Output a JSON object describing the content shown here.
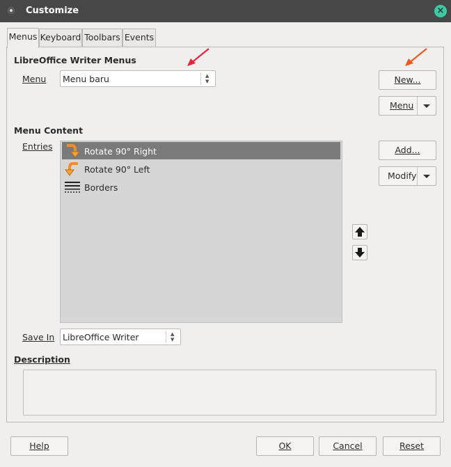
{
  "window": {
    "title": "Customize"
  },
  "tabs": [
    {
      "label": "Menus",
      "active": true
    },
    {
      "label": "Keyboard",
      "active": false
    },
    {
      "label": "Toolbars",
      "active": false
    },
    {
      "label": "Events",
      "active": false
    }
  ],
  "menus_section": {
    "title": "LibreOffice Writer Menus",
    "menu_label": "Menu",
    "menu_value": "Menu baru",
    "new_button": "New...",
    "menu_button": "Menu"
  },
  "content_section": {
    "title": "Menu Content",
    "entries_label": "Entries",
    "entries": [
      {
        "label": "Rotate 90° Right",
        "icon": "rotate-right-icon",
        "selected": true
      },
      {
        "label": "Rotate 90° Left",
        "icon": "rotate-left-icon",
        "selected": false
      },
      {
        "label": "Borders",
        "icon": "borders-icon",
        "selected": false
      }
    ],
    "add_button": "Add...",
    "modify_button": "Modify",
    "save_in_label": "Save In",
    "save_in_value": "LibreOffice Writer"
  },
  "description": {
    "label": "Description",
    "text": ""
  },
  "footer": {
    "help": "Help",
    "ok": "OK",
    "cancel": "Cancel",
    "reset": "Reset"
  },
  "colors": {
    "titlebar": "#474747",
    "close_button": "#3fc9a6",
    "selection": "#7a7a7a",
    "annotation_arrow": "#e8233a"
  }
}
